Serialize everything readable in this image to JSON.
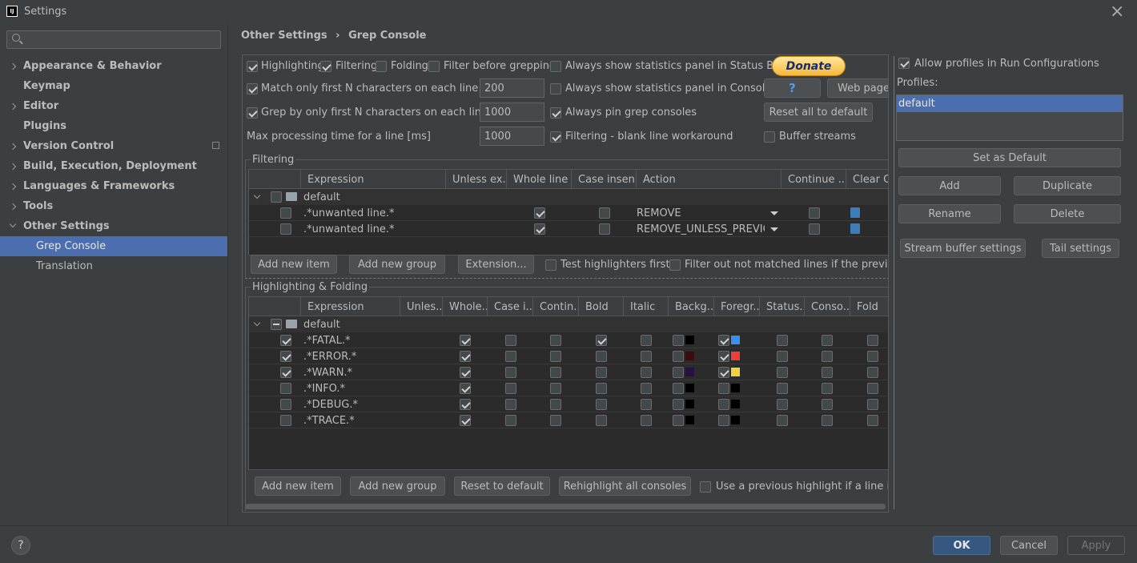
{
  "window": {
    "title": "Settings",
    "close_glyph": "×",
    "app_icon_text": "IJ"
  },
  "sidebar": {
    "search_placeholder": "",
    "items": [
      {
        "label": "Appearance & Behavior"
      },
      {
        "label": "Keymap"
      },
      {
        "label": "Editor"
      },
      {
        "label": "Plugins"
      },
      {
        "label": "Version Control"
      },
      {
        "label": "Build, Execution, Deployment"
      },
      {
        "label": "Languages & Frameworks"
      },
      {
        "label": "Tools"
      },
      {
        "label": "Other Settings"
      },
      {
        "label": "Grep Console"
      },
      {
        "label": "Translation"
      }
    ]
  },
  "breadcrumb": {
    "parent": "Other Settings",
    "separator": "›",
    "current": "Grep Console"
  },
  "options": {
    "highlighting": "Highlighting",
    "filtering": "Filtering",
    "folding": "Folding",
    "filter_before_grepping": "Filter before grepping",
    "always_stats_status_bar": "Always show statistics panel in Status Bar",
    "match_first_n": "Match only first N characters on each line",
    "match_first_n_value": "200",
    "always_stats_console": "Always show statistics panel in Console",
    "grep_first_n": "Grep by only first N characters on each line",
    "grep_first_n_value": "1000",
    "always_pin": "Always pin grep consoles",
    "max_processing": "Max processing time for a line [ms]",
    "max_processing_value": "1000",
    "blank_line_workaround": "Filtering - blank line workaround",
    "buffer_streams": "Buffer streams"
  },
  "top_buttons": {
    "donate": "Donate",
    "help": "?",
    "web_page": "Web page",
    "reset_all": "Reset all to default"
  },
  "filtering": {
    "title": "Filtering",
    "columns": [
      "Expression",
      "Unless ex...",
      "Whole line",
      "Case insen...",
      "Action",
      "Continue ...",
      "Clear Co"
    ],
    "group": "default",
    "rows": [
      {
        "expression": ".*unwanted line.*",
        "action": "REMOVE"
      },
      {
        "expression": ".*unwanted line.*",
        "action": "REMOVE_UNLESS_PREVIO..."
      }
    ],
    "buttons": {
      "add_item": "Add new item",
      "add_group": "Add new group",
      "extension": "Extension..."
    },
    "test_first": "Test highlighters first",
    "filter_out": "Filter out not matched lines if the previous c"
  },
  "highlighting": {
    "title": "Highlighting & Folding",
    "columns": [
      "Expression",
      "Unles...",
      "Whole...",
      "Case i...",
      "Contin...",
      "Bold",
      "Italic",
      "Backg...",
      "Foregr...",
      "Status...",
      "Conso...",
      "Fold"
    ],
    "group": "default",
    "rows": [
      {
        "expression": ".*FATAL.*",
        "bg": "#000000",
        "fg": "#3592f2"
      },
      {
        "expression": ".*ERROR.*",
        "bg": "#3c0a0a",
        "fg": "#f23c3c"
      },
      {
        "expression": ".*WARN.*",
        "bg": "#241244",
        "fg": "#f2d23c"
      },
      {
        "expression": ".*INFO.*",
        "bg": "#000000",
        "fg": "#000000"
      },
      {
        "expression": ".*DEBUG.*",
        "bg": "#000000",
        "fg": "#000000"
      },
      {
        "expression": ".*TRACE.*",
        "bg": "#000000",
        "fg": "#000000"
      }
    ],
    "buttons": {
      "add_item": "Add new item",
      "add_group": "Add new group",
      "reset": "Reset to default",
      "rehighlight": "Rehighlight all consoles"
    },
    "use_previous": "Use a previous highlight if a line is no"
  },
  "profiles": {
    "allow_label": "Allow profiles in Run Configurations",
    "label": "Profiles:",
    "items": [
      "default"
    ],
    "buttons": {
      "set_default": "Set as Default",
      "add": "Add",
      "duplicate": "Duplicate",
      "rename": "Rename",
      "delete": "Delete",
      "stream_buffer": "Stream buffer settings",
      "tail": "Tail settings"
    }
  },
  "footer": {
    "help": "?",
    "ok": "OK",
    "cancel": "Cancel",
    "apply": "Apply"
  },
  "colors": {
    "accent": "#4b6eaf",
    "selection": "#4b6eaf",
    "ok_button": "#365880"
  }
}
